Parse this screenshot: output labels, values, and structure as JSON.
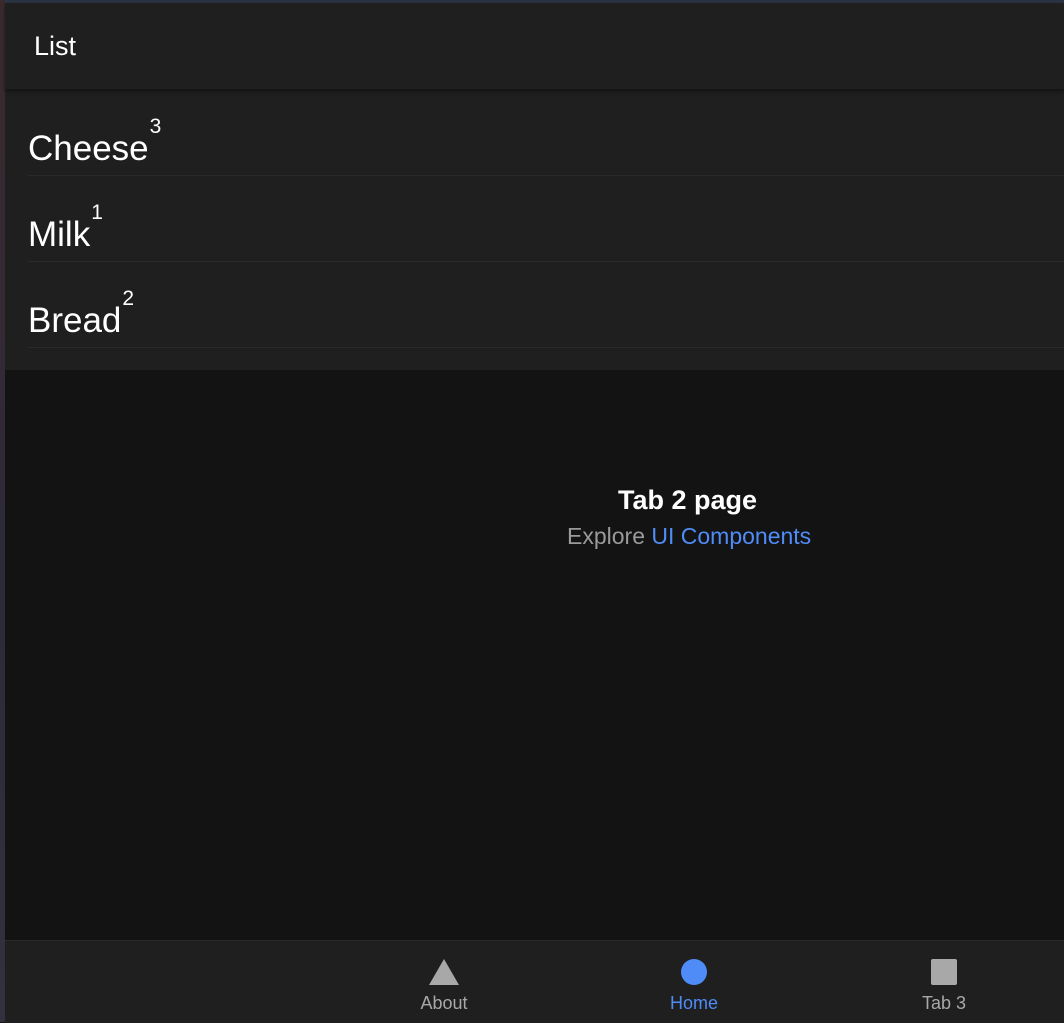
{
  "header": {
    "title": "List"
  },
  "list": {
    "items": [
      {
        "label": "Cheese",
        "count": "3"
      },
      {
        "label": "Milk",
        "count": "1"
      },
      {
        "label": "Bread",
        "count": "2"
      }
    ]
  },
  "content": {
    "title": "Tab 2 page",
    "subtitle_prefix": "Explore",
    "link_text": "UI Components"
  },
  "tabbar": {
    "tabs": [
      {
        "label": "About",
        "icon": "triangle-icon"
      },
      {
        "label": "Home",
        "icon": "circle-icon",
        "selected": true
      },
      {
        "label": "Tab 3",
        "icon": "square-icon"
      }
    ]
  },
  "colors": {
    "accent": "#4f8cf7",
    "surface": "#1f1f1f",
    "background": "#131313",
    "inactive": "#a8a8a8"
  }
}
